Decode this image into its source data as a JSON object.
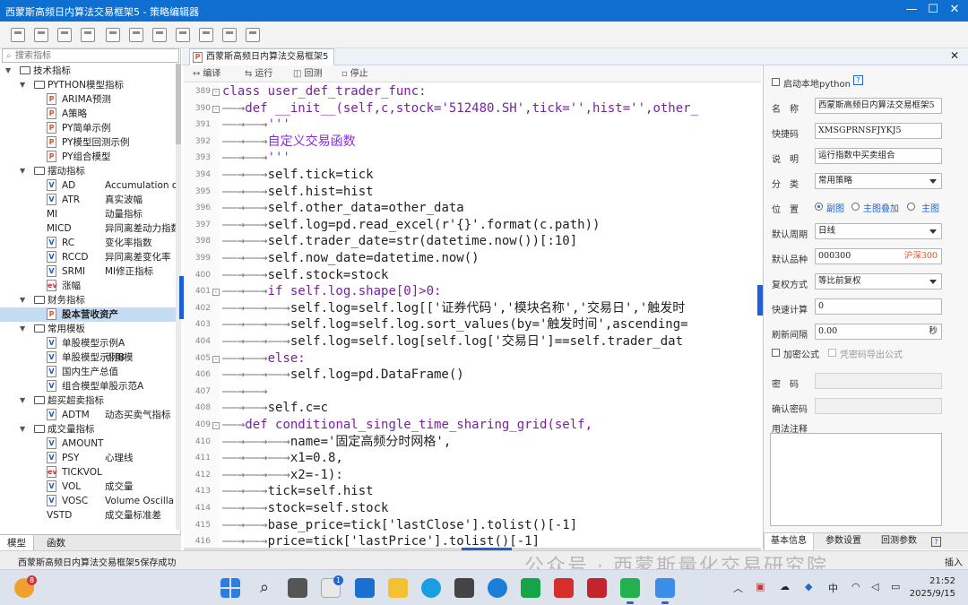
{
  "app": {
    "title": "西蒙斯高频日内算法交易框架5 - 策略编辑器",
    "window_controls": {
      "minimize": "—",
      "maximize": "☐",
      "close": "✕"
    }
  },
  "search": {
    "placeholder": "搜索指标"
  },
  "tree": [
    {
      "level": 0,
      "type": "folder",
      "label": "技术指标"
    },
    {
      "level": 1,
      "type": "folder",
      "label": "PYTHON模型指标"
    },
    {
      "level": 2,
      "type": "p",
      "label": "ARIMA预测"
    },
    {
      "level": 2,
      "type": "p",
      "label": "A策略"
    },
    {
      "level": 2,
      "type": "p",
      "label": "PY简单示例"
    },
    {
      "level": 2,
      "type": "p",
      "label": "PY模型回测示例"
    },
    {
      "level": 2,
      "type": "p",
      "label": "PY组合模型"
    },
    {
      "level": 1,
      "type": "folder",
      "label": "摆动指标"
    },
    {
      "level": 2,
      "type": "v",
      "label": "AD",
      "desc": "Accumulation or"
    },
    {
      "level": 2,
      "type": "v",
      "label": "ATR",
      "desc": "真实波幅"
    },
    {
      "level": 2,
      "type": "none",
      "label": "MI",
      "desc": "动量指标"
    },
    {
      "level": 2,
      "type": "none",
      "label": "MICD",
      "desc": "异同离差动力指数"
    },
    {
      "level": 2,
      "type": "v",
      "label": "RC",
      "desc": "变化率指数"
    },
    {
      "level": 2,
      "type": "v",
      "label": "RCCD",
      "desc": "异同离差变化率"
    },
    {
      "level": 2,
      "type": "v",
      "label": "SRMI",
      "desc": "MI修正指标"
    },
    {
      "level": 2,
      "type": "ev",
      "label": "涨幅"
    },
    {
      "level": 1,
      "type": "folder",
      "label": "财务指标"
    },
    {
      "level": 2,
      "type": "p",
      "label": "股本营收资产",
      "selected": true
    },
    {
      "level": 1,
      "type": "folder",
      "label": "常用模板"
    },
    {
      "level": 2,
      "type": "v",
      "label": "单股模型示例A"
    },
    {
      "level": 2,
      "type": "v",
      "label": "单股模型示例B",
      "desc": "引用模"
    },
    {
      "level": 2,
      "type": "v",
      "label": "国内生产总值"
    },
    {
      "level": 2,
      "type": "v",
      "label": "组合模型单股示范A"
    },
    {
      "level": 1,
      "type": "folder",
      "label": "超买超卖指标"
    },
    {
      "level": 2,
      "type": "v",
      "label": "ADTM",
      "desc": "动态买卖气指标"
    },
    {
      "level": 1,
      "type": "folder",
      "label": "成交量指标"
    },
    {
      "level": 2,
      "type": "v",
      "label": "AMOUNT"
    },
    {
      "level": 2,
      "type": "v",
      "label": "PSY",
      "desc": "心理线"
    },
    {
      "level": 2,
      "type": "ev",
      "label": "TICKVOL"
    },
    {
      "level": 2,
      "type": "v",
      "label": "VOL",
      "desc": "成交量"
    },
    {
      "level": 2,
      "type": "v",
      "label": "VOSC",
      "desc": "Volume Oscilla"
    },
    {
      "level": 2,
      "type": "none",
      "label": "VSTD",
      "desc": "成交量标准差"
    }
  ],
  "left_tabs": [
    "模型",
    "函数"
  ],
  "doc_tab": {
    "label": "西蒙斯高频日内算法交易框架5",
    "icon": "P"
  },
  "editor_tools": [
    {
      "name": "compile",
      "label": "编译",
      "icon": "↔"
    },
    {
      "name": "run",
      "label": "运行",
      "icon": "⇆"
    },
    {
      "name": "backtest",
      "label": "回测",
      "icon": "◫"
    },
    {
      "name": "stop",
      "label": "停止",
      "icon": "▫"
    }
  ],
  "code": [
    {
      "n": "389",
      "fold": "-",
      "indent": 0,
      "text": "class user_def_trader_func:"
    },
    {
      "n": "390",
      "fold": "-",
      "indent": 1,
      "text": "def __init__(self,c,stock='512480.SH',tick='',hist='',other_"
    },
    {
      "n": "391",
      "indent": 2,
      "text": "'''"
    },
    {
      "n": "392",
      "indent": 2,
      "text": "自定义交易函数"
    },
    {
      "n": "393",
      "indent": 2,
      "text": "'''"
    },
    {
      "n": "394",
      "indent": 2,
      "text": "self.tick=tick"
    },
    {
      "n": "395",
      "indent": 2,
      "text": "self.hist=hist"
    },
    {
      "n": "396",
      "indent": 2,
      "text": "self.other_data=other_data"
    },
    {
      "n": "397",
      "indent": 2,
      "text": "self.log=pd.read_excel(r'{}'.format(c.path))"
    },
    {
      "n": "398",
      "indent": 2,
      "text": "self.trader_date=str(datetime.now())[:10]"
    },
    {
      "n": "399",
      "indent": 2,
      "text": "self.now_date=datetime.now()"
    },
    {
      "n": "400",
      "indent": 2,
      "text": "self.stock=stock"
    },
    {
      "n": "401",
      "fold": "-",
      "indent": 2,
      "text": "if self.log.shape[0]>0:"
    },
    {
      "n": "402",
      "indent": 3,
      "text": "self.log=self.log[['证券代码','模块名称','交易日','触发时"
    },
    {
      "n": "403",
      "indent": 3,
      "text": "self.log=self.log.sort_values(by='触发时间',ascending="
    },
    {
      "n": "404",
      "indent": 3,
      "text": "self.log=self.log[self.log['交易日']==self.trader_dat"
    },
    {
      "n": "405",
      "fold": "-",
      "indent": 2,
      "text": "else:"
    },
    {
      "n": "406",
      "indent": 3,
      "text": "self.log=pd.DataFrame()"
    },
    {
      "n": "407",
      "indent": 2,
      "text": ""
    },
    {
      "n": "408",
      "indent": 2,
      "text": "self.c=c"
    },
    {
      "n": "409",
      "fold": "-",
      "indent": 1,
      "text": "def conditional_single_time_sharing_grid(self,"
    },
    {
      "n": "410",
      "indent": 3,
      "text": "name='固定高频分时网格',"
    },
    {
      "n": "411",
      "indent": 3,
      "text": "x1=0.8,"
    },
    {
      "n": "412",
      "indent": 3,
      "text": "x2=-1):"
    },
    {
      "n": "413",
      "indent": 2,
      "text": "tick=self.hist"
    },
    {
      "n": "414",
      "indent": 2,
      "text": "stock=self.stock"
    },
    {
      "n": "415",
      "indent": 2,
      "text": "base_price=tick['lastClose'].tolist()[-1]"
    },
    {
      "n": "416",
      "indent": 2,
      "text": "price=tick['lastPrice'].tolist()[-1]"
    }
  ],
  "props": {
    "local_python_label": "启动本地python",
    "name_label": "名　称",
    "name_value": "西蒙斯高频日内算法交易框架5",
    "shortcut_label": "快捷码",
    "shortcut_value": "XMSGPRNSFJYKJ5",
    "desc_label": "说　明",
    "desc_value": "运行指数中买卖组合",
    "category_label": "分　类",
    "category_value": "常用策略",
    "position_label": "位　置",
    "position_options": [
      "副图",
      "主图叠加",
      "主图"
    ],
    "period_label": "默认周期",
    "period_value": "日线",
    "symbol_label": "默认品种",
    "symbol_value": "000300",
    "symbol_name": "沪深300",
    "adjust_label": "复权方式",
    "adjust_value": "等比前复权",
    "fastcalc_label": "快速计算",
    "fastcalc_value": "0",
    "refresh_label": "刷新间隔",
    "refresh_value": "0.00",
    "refresh_unit": "秒",
    "encrypt_label": "加密公式",
    "export_label": "凭密码导出公式",
    "pwd_label": "密　码",
    "confirm_label": "确认密码",
    "notes_label": "用法注释",
    "tabs": [
      "基本信息",
      "参数设置",
      "回测参数"
    ],
    "help": "?"
  },
  "status": {
    "message": "西蒙斯高频日内算法交易框架5保存成功",
    "mode": "插入"
  },
  "watermark": "公众号 · 西蒙斯量化交易研究院",
  "taskbar": {
    "badge_start": "8",
    "badge_app": "1",
    "ime": "中",
    "time": "21:52",
    "date": "2025/9/15"
  }
}
